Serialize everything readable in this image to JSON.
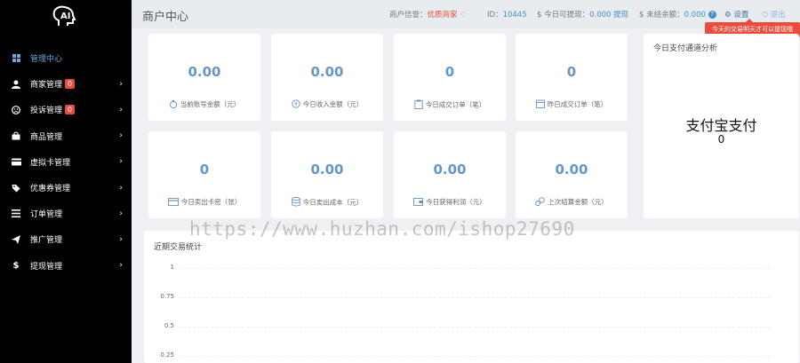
{
  "logo": {
    "text": "AI"
  },
  "sidebar": {
    "items": [
      {
        "label": "管理中心",
        "icon": "dashboard-icon",
        "badge": "",
        "arrow": ""
      },
      {
        "label": "商家管理",
        "icon": "user-icon",
        "badge": "0",
        "arrow": "›"
      },
      {
        "label": "投诉管理",
        "icon": "frown-icon",
        "badge": "0",
        "arrow": "›"
      },
      {
        "label": "商品管理",
        "icon": "bag-icon",
        "badge": "",
        "arrow": "›"
      },
      {
        "label": "虚拟卡管理",
        "icon": "card-icon",
        "badge": "",
        "arrow": "›"
      },
      {
        "label": "优惠券管理",
        "icon": "tag-icon",
        "badge": "",
        "arrow": "›"
      },
      {
        "label": "订单管理",
        "icon": "list-icon",
        "badge": "",
        "arrow": "›"
      },
      {
        "label": "推广管理",
        "icon": "send-icon",
        "badge": "",
        "arrow": "›"
      },
      {
        "label": "提现管理",
        "icon": "dollar-icon",
        "badge": "",
        "arrow": "›"
      }
    ]
  },
  "header": {
    "title": "商户中心",
    "credit_label": "商户信誉：",
    "credit_value": "优质商家",
    "id_label": "ID：",
    "id_value": "10445",
    "withdrawable_label": "$ 今日可提现：",
    "withdrawable_value": "0.000",
    "withdraw_link": "提现",
    "unsettled_label": "$ 未结余额：",
    "unsettled_value": "0.000",
    "help": "?",
    "settings": "设置",
    "logout": "退出",
    "tooltip": "今天的交易明天才可以提现哦"
  },
  "cards": [
    {
      "value": "0.00",
      "label": "当前账号金额（元）",
      "icon": "money-bag-icon"
    },
    {
      "value": "0.00",
      "label": "今日收入金额（元）",
      "icon": "coin-icon"
    },
    {
      "value": "0",
      "label": "今日成交订单（笔）",
      "icon": "clipboard-icon"
    },
    {
      "value": "0",
      "label": "昨日成交订单（笔）",
      "icon": "calendar-icon"
    },
    {
      "value": "0",
      "label": "今日卖出卡密（张）",
      "icon": "credit-card-icon"
    },
    {
      "value": "0.00",
      "label": "今日卖出成本（元）",
      "icon": "database-icon"
    },
    {
      "value": "0.00",
      "label": "今日获得利润（元）",
      "icon": "wallet-icon"
    },
    {
      "value": "0.00",
      "label": "上次结算金额（元）",
      "icon": "coins-icon"
    }
  ],
  "pay_channel": {
    "title": "今日支付通道分析",
    "name": "支付宝支付",
    "value": "0"
  },
  "stats": {
    "title": "近期交易统计",
    "yticks": [
      "1",
      "0.75",
      "0.5",
      "0.25"
    ]
  },
  "watermark": "https://www.huzhan.com/ishop27690"
}
